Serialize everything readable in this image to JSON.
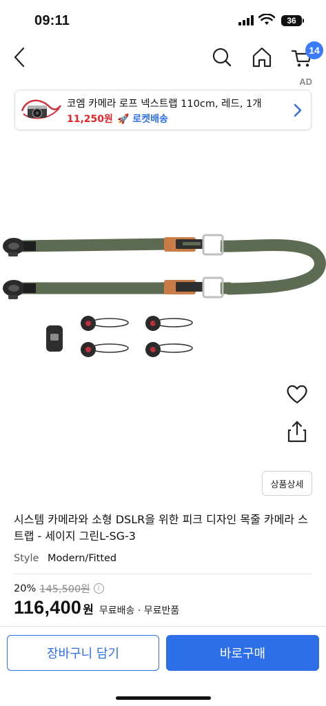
{
  "status_bar": {
    "time": "09:11",
    "battery": "36"
  },
  "nav": {
    "cart_count": "14",
    "ad_label": "AD"
  },
  "ad_banner": {
    "title": "코엠 카메라 로프 넥스트랩 110cm, 레드, 1개",
    "price": "11,250원",
    "rocket": "🚀 로켓배송"
  },
  "product": {
    "detail_button": "상품상세",
    "title": "시스템 카메라와 소형 DSLR을 위한 피크 디자인 목줄 카메라 스트랩 - 세이지 그린L-SG-3",
    "style_key": "Style",
    "style_value": "Modern/Fitted",
    "discount": "20%",
    "original_price": "145,500원",
    "price": "116,400",
    "currency": "원",
    "shipping": "무료배송 · 무료반품"
  },
  "actions": {
    "add_to_cart": "장바구니 담기",
    "buy_now": "바로구매"
  },
  "colors": {
    "accent": "#2d6fe8",
    "sale_red": "#e52528",
    "strap_green": "#5c6b52",
    "leather": "#c97c45"
  }
}
